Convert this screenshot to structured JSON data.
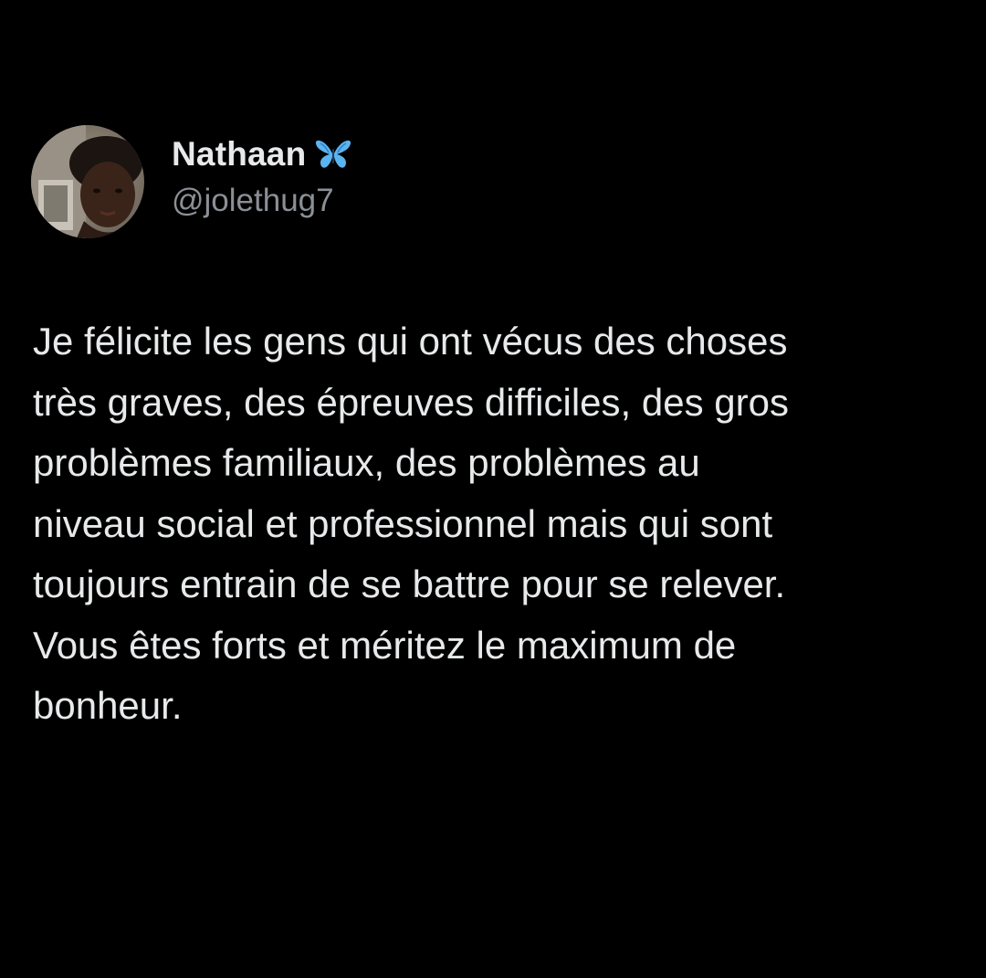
{
  "author": {
    "display_name": "Nathaan",
    "badge_icon": "butterfly-emoji-icon",
    "handle": "@jolethug7",
    "avatar_icon": "profile-photo"
  },
  "tweet": {
    "lines": [
      "Je félicite les gens qui ont vécus des choses",
      "très graves, des épreuves difficiles, des gros",
      "problèmes familiaux, des problèmes au",
      "niveau social et professionnel mais qui sont",
      "toujours entrain de se battre pour se relever.",
      "Vous êtes forts et méritez le maximum de",
      "bonheur."
    ]
  },
  "colors": {
    "background": "#000000",
    "text_primary": "#e7e9ea",
    "text_secondary": "#8b9096",
    "badge_blue": "#5ab4f0"
  }
}
